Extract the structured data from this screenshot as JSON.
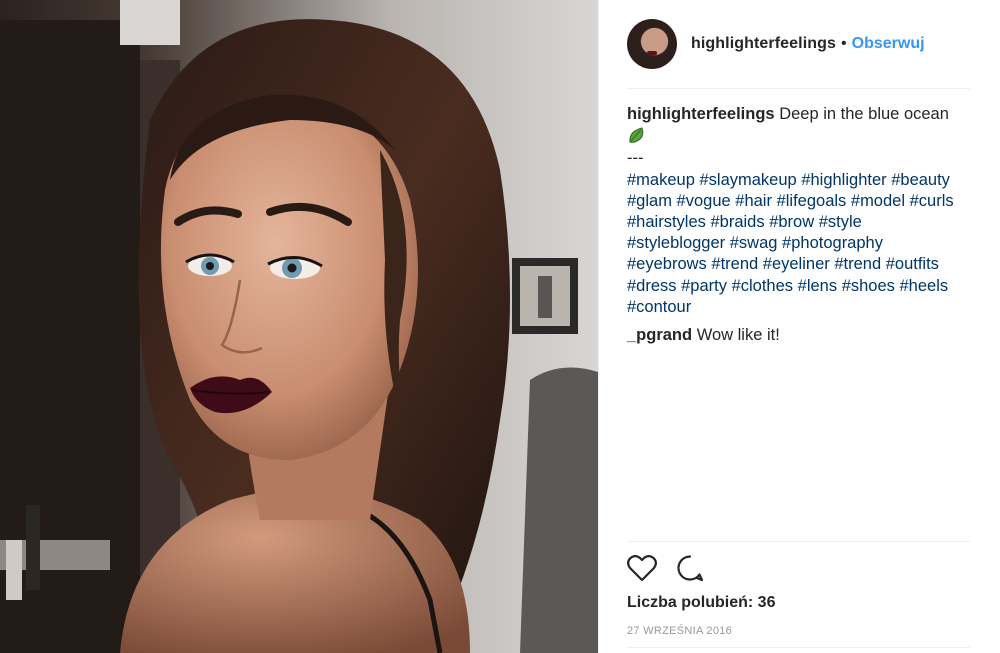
{
  "post": {
    "username": "highlighterfeelings",
    "separator": "•",
    "follow_label": "Obserwuj",
    "caption": {
      "username": "highlighterfeelings",
      "text": "Deep in the blue ocean",
      "emoji_icon": "leaf-icon",
      "dash": "---",
      "hashtags": [
        "#makeup",
        "#slaymakeup",
        "#highlighter",
        "#beauty",
        "#glam",
        "#vogue",
        "#hair",
        "#lifegoals",
        "#model",
        "#curls",
        "#hairstyles",
        "#braids",
        "#brow",
        "#style",
        "#styleblogger",
        "#swag",
        "#photography",
        "#eyebrows",
        "#trend",
        "#eyeliner",
        "#trend",
        "#outfits",
        "#dress",
        "#party",
        "#clothes",
        "#lens",
        "#shoes",
        "#heels",
        "#contour"
      ]
    },
    "reply": {
      "username": "_pgrand",
      "text": "Wow like it!"
    },
    "likes_label": "Liczba polubień: 36",
    "date": "27 września 2016"
  },
  "icons": {
    "like": "heart-icon",
    "comment": "comment-icon"
  },
  "colors": {
    "link": "#3897f0",
    "hashtag": "#003569",
    "text": "#262626",
    "muted": "#999999"
  }
}
